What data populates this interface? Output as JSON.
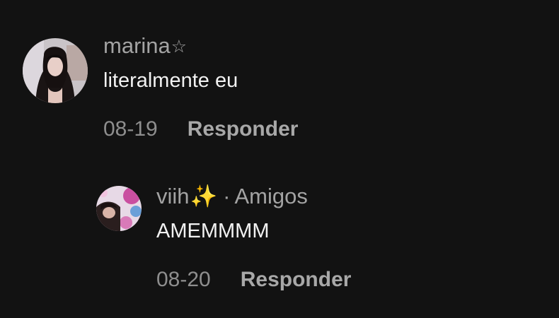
{
  "comments": [
    {
      "username": "marina",
      "username_suffix": "☆",
      "text": "literalmente eu",
      "date": "08-19",
      "reply_label": "Responder",
      "avatar_icon": "user-avatar-photo"
    },
    {
      "username": "viih",
      "username_suffix": "✨",
      "separator": "·",
      "relation": "Amigos",
      "text": "AMEMMMM",
      "date": "08-20",
      "reply_label": "Responder",
      "avatar_icon": "user-avatar-photo"
    }
  ],
  "colors": {
    "background": "#121212",
    "username": "#a3a3a3",
    "text": "#f2f2f2",
    "meta": "#8e8e8e"
  }
}
